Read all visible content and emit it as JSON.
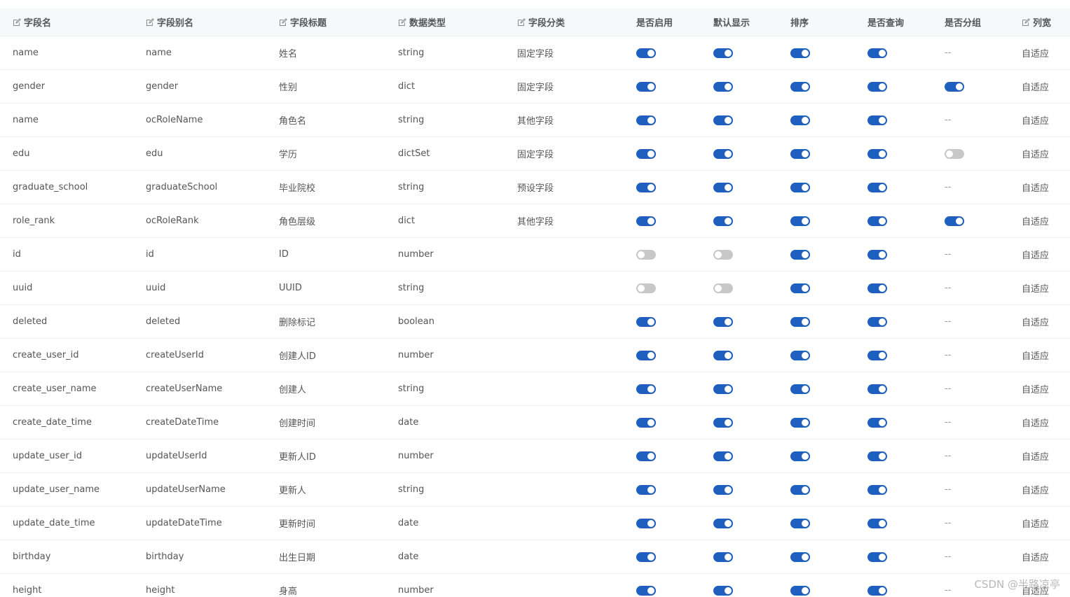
{
  "colors": {
    "accent": "#1e5fbf",
    "switch_off": "#c8c8c8",
    "header_bg": "#f7f8fa"
  },
  "headers": [
    {
      "label": "字段名",
      "editable": true
    },
    {
      "label": "字段别名",
      "editable": true
    },
    {
      "label": "字段标题",
      "editable": true
    },
    {
      "label": "数据类型",
      "editable": true
    },
    {
      "label": "字段分类",
      "editable": true
    },
    {
      "label": "是否启用",
      "editable": false
    },
    {
      "label": "默认显示",
      "editable": false
    },
    {
      "label": "排序",
      "editable": false
    },
    {
      "label": "是否查询",
      "editable": false
    },
    {
      "label": "是否分组",
      "editable": false
    },
    {
      "label": "列宽",
      "editable": true
    }
  ],
  "rows": [
    {
      "name": "name",
      "alias": "name",
      "title": "姓名",
      "type": "string",
      "category": "固定字段",
      "enabled": true,
      "display": true,
      "sort": true,
      "query": true,
      "group": null,
      "width": "自适应"
    },
    {
      "name": "gender",
      "alias": "gender",
      "title": "性别",
      "type": "dict",
      "category": "固定字段",
      "enabled": true,
      "display": true,
      "sort": true,
      "query": true,
      "group": true,
      "width": "自适应"
    },
    {
      "name": "name",
      "alias": "ocRoleName",
      "title": "角色名",
      "type": "string",
      "category": "其他字段",
      "enabled": true,
      "display": true,
      "sort": true,
      "query": true,
      "group": null,
      "width": "自适应"
    },
    {
      "name": "edu",
      "alias": "edu",
      "title": "学历",
      "type": "dictSet",
      "category": "固定字段",
      "enabled": true,
      "display": true,
      "sort": true,
      "query": true,
      "group": false,
      "width": "自适应"
    },
    {
      "name": "graduate_school",
      "alias": "graduateSchool",
      "title": "毕业院校",
      "type": "string",
      "category": "预设字段",
      "enabled": true,
      "display": true,
      "sort": true,
      "query": true,
      "group": null,
      "width": "自适应"
    },
    {
      "name": "role_rank",
      "alias": "ocRoleRank",
      "title": "角色层级",
      "type": "dict",
      "category": "其他字段",
      "enabled": true,
      "display": true,
      "sort": true,
      "query": true,
      "group": true,
      "width": "自适应"
    },
    {
      "name": "id",
      "alias": "id",
      "title": "ID",
      "type": "number",
      "category": "",
      "enabled": false,
      "display": false,
      "sort": true,
      "query": true,
      "group": null,
      "width": "自适应"
    },
    {
      "name": "uuid",
      "alias": "uuid",
      "title": "UUID",
      "type": "string",
      "category": "",
      "enabled": false,
      "display": false,
      "sort": true,
      "query": true,
      "group": null,
      "width": "自适应"
    },
    {
      "name": "deleted",
      "alias": "deleted",
      "title": "删除标记",
      "type": "boolean",
      "category": "",
      "enabled": true,
      "display": true,
      "sort": true,
      "query": true,
      "group": null,
      "width": "自适应"
    },
    {
      "name": "create_user_id",
      "alias": "createUserId",
      "title": "创建人ID",
      "type": "number",
      "category": "",
      "enabled": true,
      "display": true,
      "sort": true,
      "query": true,
      "group": null,
      "width": "自适应"
    },
    {
      "name": "create_user_name",
      "alias": "createUserName",
      "title": "创建人",
      "type": "string",
      "category": "",
      "enabled": true,
      "display": true,
      "sort": true,
      "query": true,
      "group": null,
      "width": "自适应"
    },
    {
      "name": "create_date_time",
      "alias": "createDateTime",
      "title": "创建时间",
      "type": "date",
      "category": "",
      "enabled": true,
      "display": true,
      "sort": true,
      "query": true,
      "group": null,
      "width": "自适应"
    },
    {
      "name": "update_user_id",
      "alias": "updateUserId",
      "title": "更新人ID",
      "type": "number",
      "category": "",
      "enabled": true,
      "display": true,
      "sort": true,
      "query": true,
      "group": null,
      "width": "自适应"
    },
    {
      "name": "update_user_name",
      "alias": "updateUserName",
      "title": "更新人",
      "type": "string",
      "category": "",
      "enabled": true,
      "display": true,
      "sort": true,
      "query": true,
      "group": null,
      "width": "自适应"
    },
    {
      "name": "update_date_time",
      "alias": "updateDateTime",
      "title": "更新时间",
      "type": "date",
      "category": "",
      "enabled": true,
      "display": true,
      "sort": true,
      "query": true,
      "group": null,
      "width": "自适应"
    },
    {
      "name": "birthday",
      "alias": "birthday",
      "title": "出生日期",
      "type": "date",
      "category": "",
      "enabled": true,
      "display": true,
      "sort": true,
      "query": true,
      "group": null,
      "width": "自适应"
    },
    {
      "name": "height",
      "alias": "height",
      "title": "身高",
      "type": "number",
      "category": "",
      "enabled": true,
      "display": true,
      "sort": true,
      "query": true,
      "group": null,
      "width": "自适应"
    }
  ],
  "empty_placeholder": "--",
  "watermark": "CSDN @半路凉亭"
}
